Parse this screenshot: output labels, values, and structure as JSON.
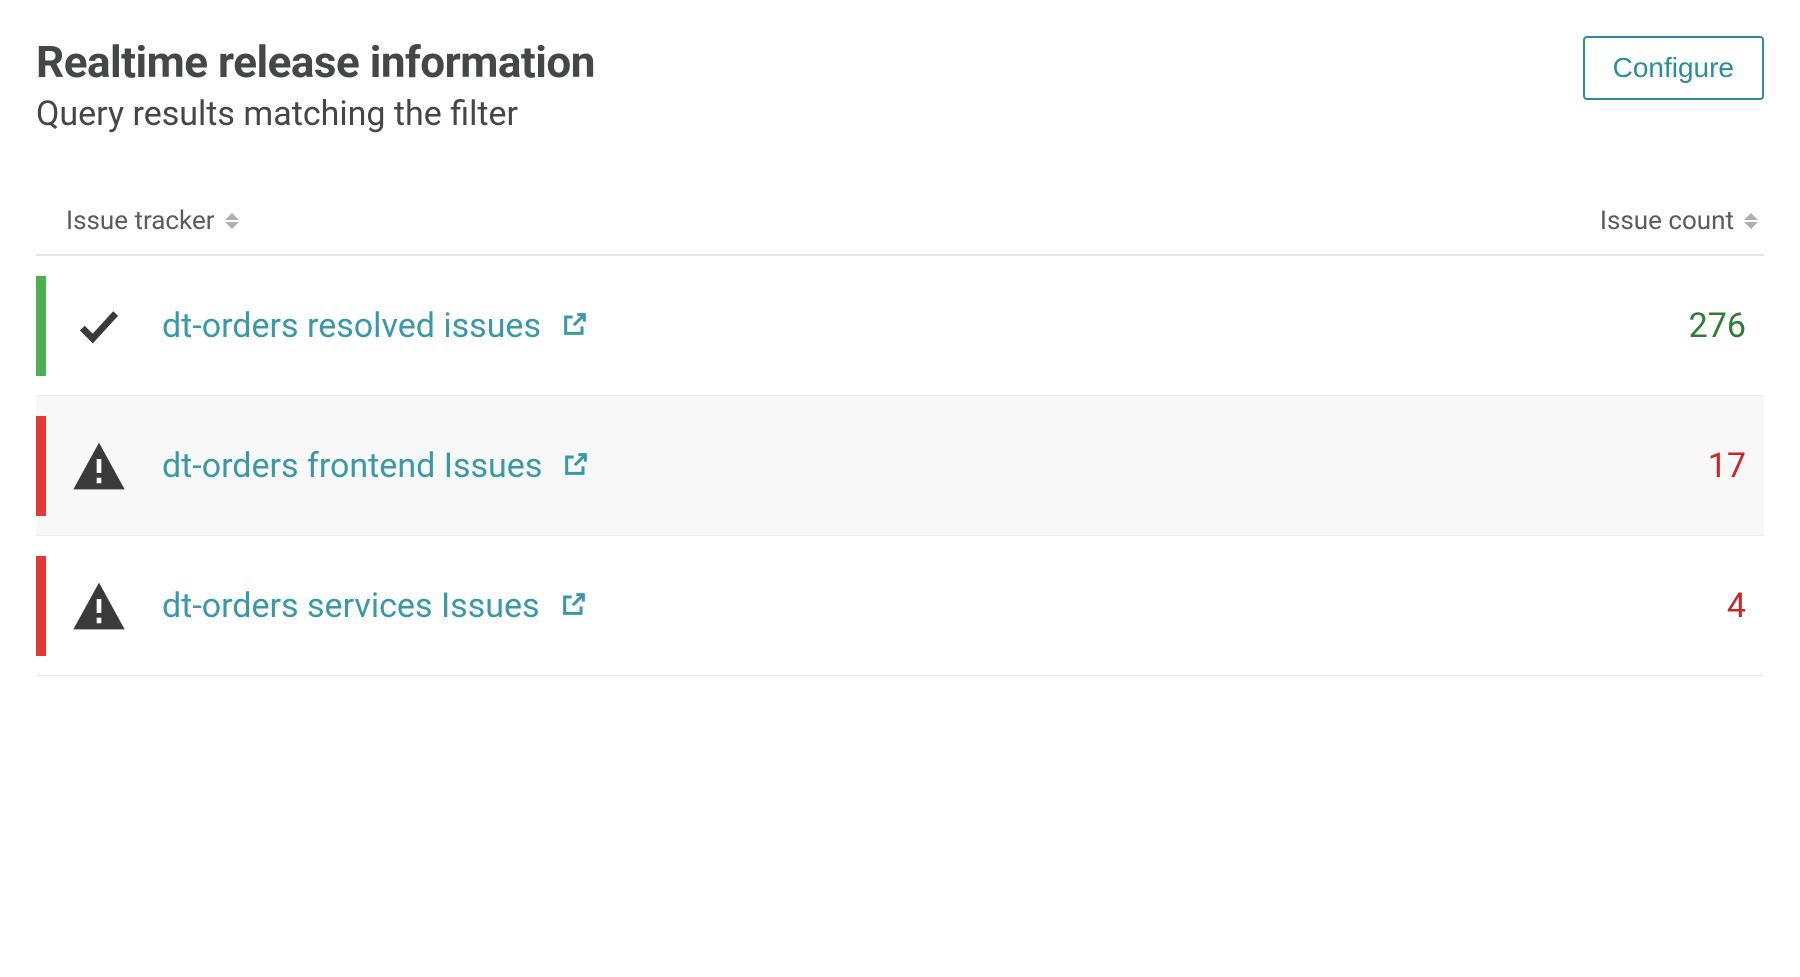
{
  "header": {
    "title": "Realtime release information",
    "subtitle": "Query results matching the filter",
    "configure_label": "Configure"
  },
  "table": {
    "columns": {
      "tracker": "Issue tracker",
      "count": "Issue count"
    },
    "rows": [
      {
        "status": "ok",
        "status_bar_color": "green",
        "icon": "checkmark",
        "label": "dt-orders resolved issues",
        "count": "276",
        "count_color": "green"
      },
      {
        "status": "problem",
        "status_bar_color": "red",
        "icon": "warning",
        "label": "dt-orders frontend Issues",
        "count": "17",
        "count_color": "red"
      },
      {
        "status": "problem",
        "status_bar_color": "red",
        "icon": "warning",
        "label": "dt-orders services Issues",
        "count": "4",
        "count_color": "red"
      }
    ]
  }
}
